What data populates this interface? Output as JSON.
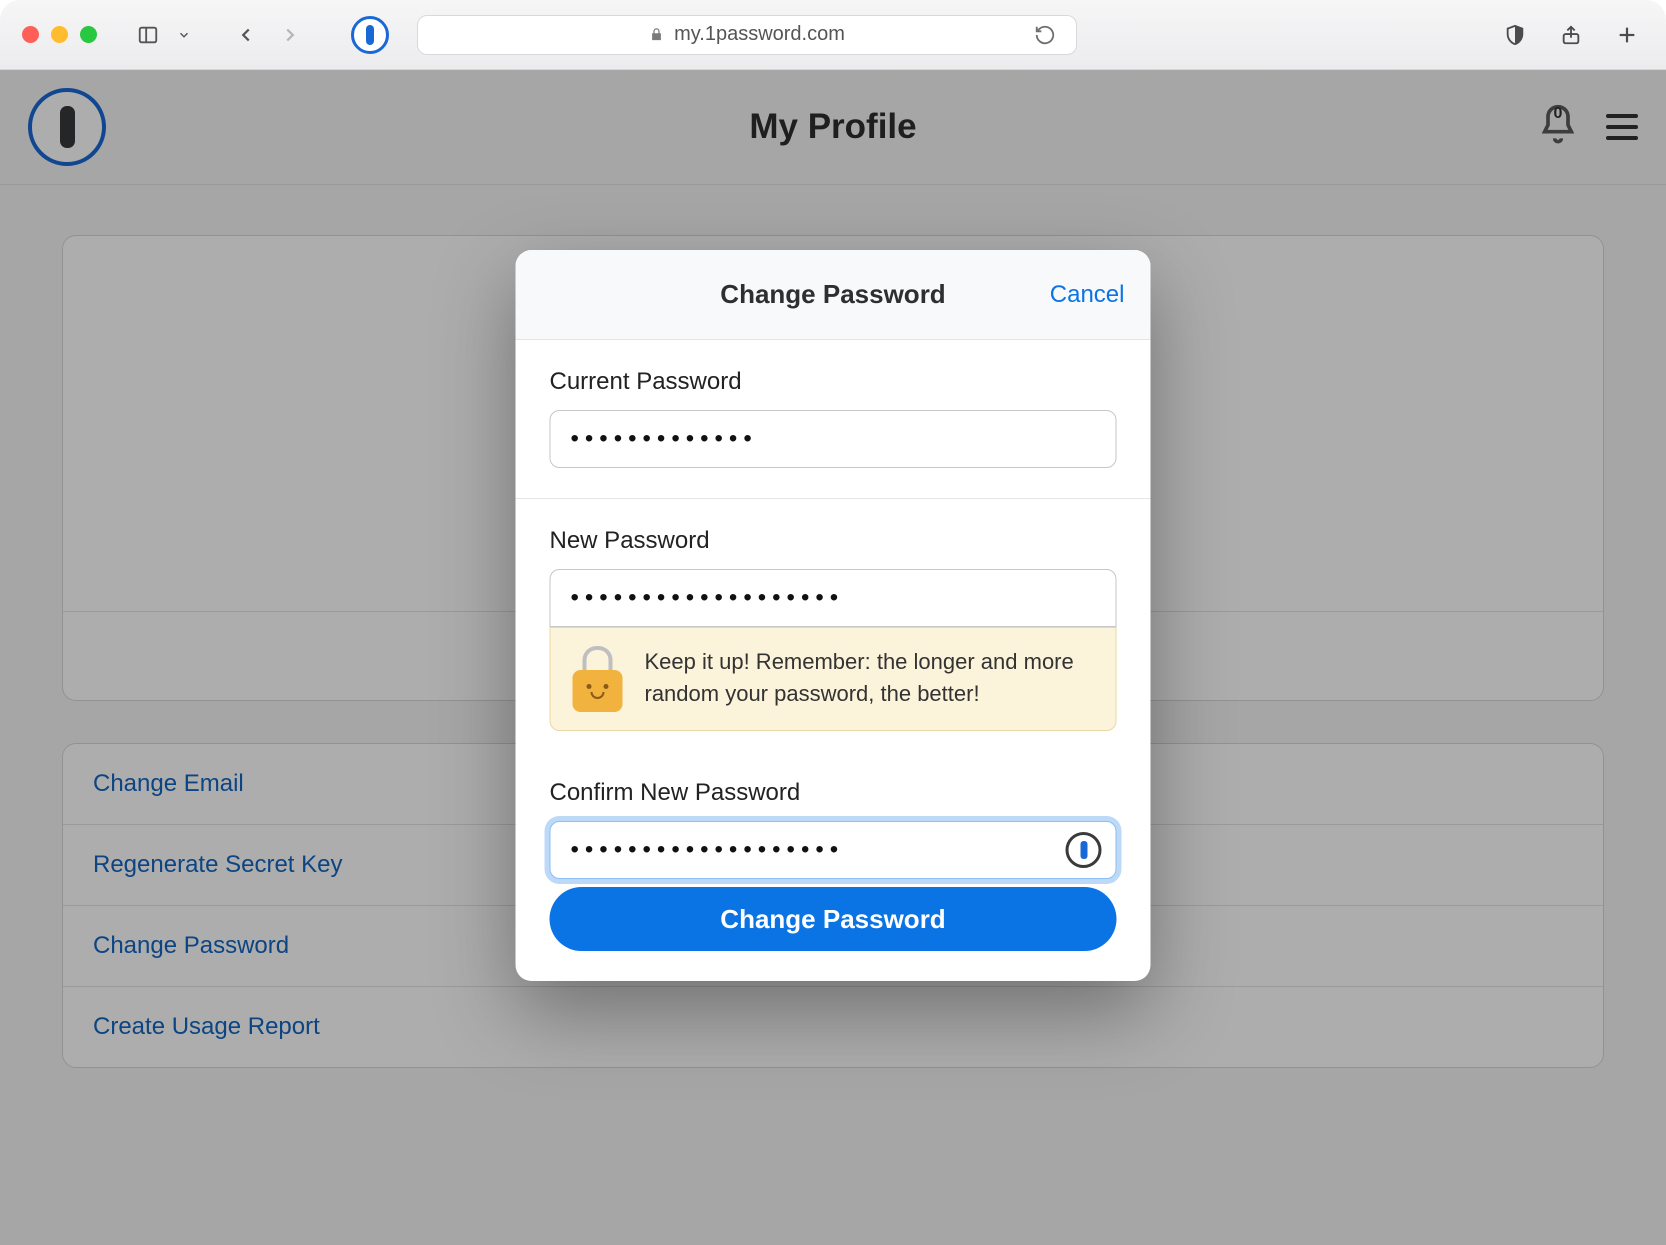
{
  "browser": {
    "url": "my.1password.com"
  },
  "header": {
    "title": "My Profile",
    "notification_count": "0"
  },
  "profile_actions": [
    "Change Email",
    "Regenerate Secret Key",
    "Change Password",
    "Create Usage Report"
  ],
  "modal": {
    "title": "Change Password",
    "cancel": "Cancel",
    "current_label": "Current Password",
    "current_value": "•••••••••••••",
    "new_label": "New Password",
    "new_value": "•••••••••••••••••••",
    "hint": "Keep it up! Remember: the longer and more random your password, the better!",
    "confirm_label": "Confirm New Password",
    "confirm_value": "•••••••••••••••••••",
    "submit": "Change Password"
  }
}
